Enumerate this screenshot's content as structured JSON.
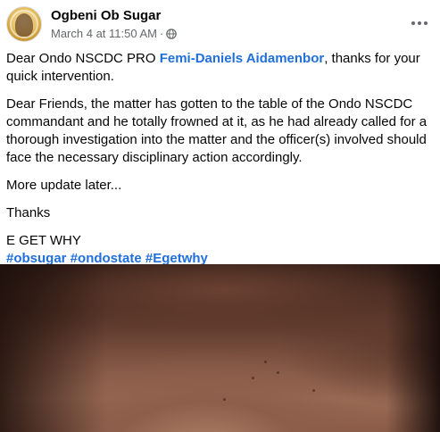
{
  "post": {
    "author": {
      "name": "Ogbeni Ob Sugar",
      "avatar_icon": "profile-photo"
    },
    "meta": {
      "timestamp": "March 4 at 11:50 AM",
      "separator": "·",
      "audience_icon": "globe-icon"
    },
    "menu_icon": "more-horizontal-icon",
    "body": {
      "p1_before": "Dear Ondo NSCDC PRO ",
      "p1_mention": "Femi-Daniels Aidamenbor",
      "p1_after": ", thanks for your quick intervention.",
      "p2": "Dear Friends, the matter has gotten to the table of the Ondo NSCDC commandant and he totally frowned at it, as he had already called for a thorough investigation into the matter and the officer(s) involved should face the necessary disciplinary action accordingly.",
      "p3": "More update later...",
      "p4": "Thanks",
      "p5": "E GET WHY",
      "hashtags": [
        "#obsugar",
        "#ondostate",
        "#Egetwhy"
      ]
    },
    "photo_description_icon": "post-photo"
  },
  "colors": {
    "link": "#216fdb",
    "secondary_text": "#65676b",
    "primary_text": "#050505"
  }
}
